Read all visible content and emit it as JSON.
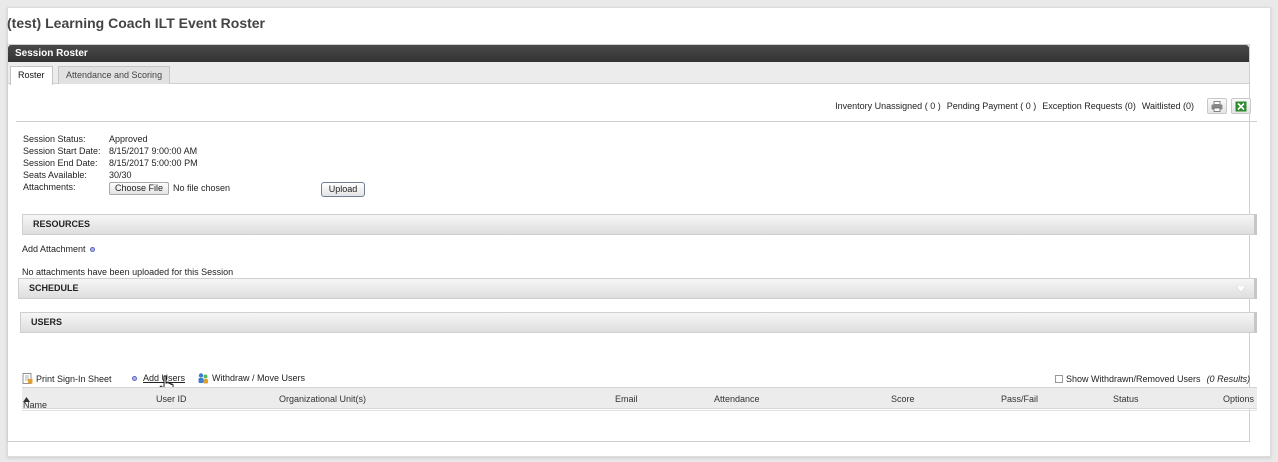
{
  "page": {
    "title": "(test) Learning Coach ILT Event Roster"
  },
  "panel": {
    "header": "Session Roster"
  },
  "tabs": [
    {
      "label": "Roster",
      "active": true
    },
    {
      "label": "Attendance and Scoring",
      "active": false
    }
  ],
  "counters": {
    "inventory": "Inventory Unassigned ( 0 )",
    "pending": "Pending Payment ( 0 )",
    "exceptions": "Exception Requests (0)",
    "waitlisted": "Waitlisted (0)"
  },
  "toolbar": {
    "print_icon": "printer-icon",
    "excel_icon": "excel-icon"
  },
  "session": {
    "status_label": "Session Status:",
    "status_value": "Approved",
    "start_label": "Session Start Date:",
    "start_value": "8/15/2017 9:00:00 AM",
    "end_label": "Session End Date:",
    "end_value": "8/15/2017 5:00:00 PM",
    "seats_label": "Seats Available:",
    "seats_value": "30/30",
    "attachments_label": "Attachments:",
    "choose_file": "Choose File",
    "no_file": "No file chosen",
    "upload": "Upload"
  },
  "resources": {
    "title": "RESOURCES",
    "add_attachment": "Add Attachment",
    "empty": "No attachments have been uploaded for this Session"
  },
  "schedule": {
    "title": "SCHEDULE"
  },
  "users": {
    "title": "USERS",
    "print_signin": "Print Sign-In Sheet",
    "add_users": "Add Users",
    "withdraw_move": "Withdraw / Move Users",
    "show_withdrawn": "Show Withdrawn/Removed Users",
    "results": "(0 Results)",
    "columns": [
      "Name",
      "User ID",
      "Organizational Unit(s)",
      "Email",
      "Attendance",
      "Score",
      "Pass/Fail",
      "Status",
      "Options"
    ]
  },
  "colors": {
    "header_bg": "#3a3a3a",
    "section_bg": "#e6e6e6",
    "excel_green": "#2e8b2e"
  }
}
